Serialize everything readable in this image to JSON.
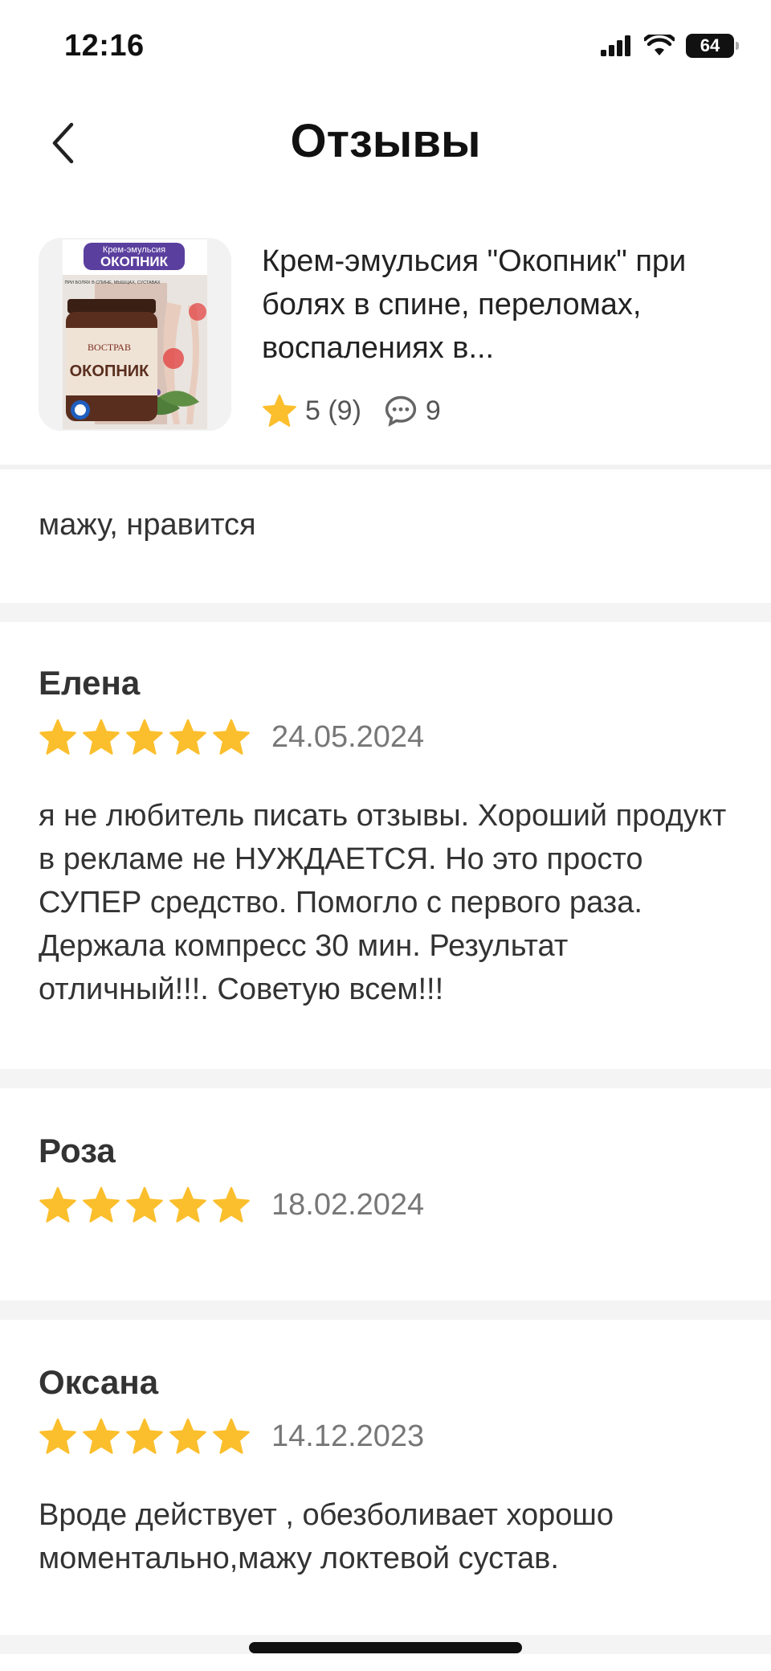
{
  "status_bar": {
    "time": "12:16",
    "battery": "64",
    "icons": [
      "cellular-signal-icon",
      "wifi-icon",
      "battery-icon"
    ]
  },
  "header": {
    "title": "Отзывы",
    "back_icon": "chevron-left-icon"
  },
  "product": {
    "name": "Крем-эмульсия \"Окопник\" при болях в спине, переломах, воспалениях в...",
    "rating": "5 (9)",
    "comments_count": "9",
    "image": {
      "brand": "Крем-эмульсия",
      "title": "ОКОПНИК",
      "subtitle": "ПРИ БОЛЯХ В СПИНЕ, МЫШЦАХ, СУСТАВАХ",
      "jar_label": "ОКОПНИК",
      "jar_brand": "ВОСТРАВ"
    }
  },
  "top_comment": {
    "text": "мажу, нравится"
  },
  "reviews": [
    {
      "author": "Елена",
      "stars": 5,
      "date": "24.05.2024",
      "text": "я не любитель писать отзывы. Хороший продукт в рекламе не НУЖДАЕТСЯ. Но это просто СУПЕР  средство. Помогло с первого раза. Держала компресс 30 мин. Результат отличный!!!. Советую всем!!!"
    },
    {
      "author": "Роза",
      "stars": 5,
      "date": "18.02.2024",
      "text": ""
    },
    {
      "author": "Оксана",
      "stars": 5,
      "date": "14.12.2023",
      "text": "Вроде действует , обезболивает хорошо моментально,мажу локтевой сустав."
    }
  ],
  "colors": {
    "star": "#FBBF2D",
    "text_primary": "#222222",
    "text_secondary": "#777777",
    "divider": "#F4F4F4",
    "label_purple": "#5B3F9E"
  }
}
